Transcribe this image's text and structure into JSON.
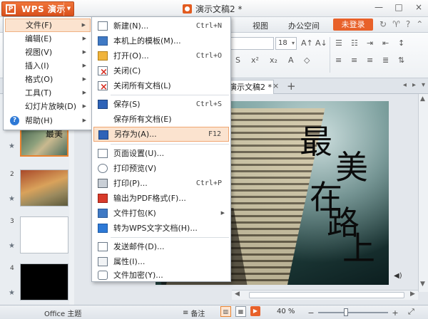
{
  "app": {
    "logo_glyph": "P",
    "menu_button_label": "WPS 演示",
    "doc_title": "演示文稿2 *"
  },
  "window": {
    "minimize": "—",
    "maximize": "□",
    "close": "×"
  },
  "menubar": {
    "tabs": [
      "视图",
      "办公空间"
    ],
    "login_label": "未登录"
  },
  "toolbar": {
    "font_size": "18",
    "grow_font": "A↑",
    "shrink_font": "A↓"
  },
  "doc_tabs": {
    "active_tab": "演示文稿2 *",
    "close": "×",
    "add": "+"
  },
  "thumbnails": {
    "slides": [
      {
        "number": "1",
        "text": "最美"
      },
      {
        "number": "2",
        "text": ""
      },
      {
        "number": "3",
        "text": ""
      },
      {
        "number": "4",
        "text": ""
      }
    ]
  },
  "slide": {
    "text_lines": [
      "最",
      "美",
      "在",
      "路",
      "上"
    ]
  },
  "statusbar": {
    "theme": "Office 主题",
    "notes": "备注",
    "zoom": "40 %",
    "zoom_level": 0.4
  },
  "wps_menu": {
    "items": [
      {
        "label": "文件(F)",
        "has_submenu": true
      },
      {
        "label": "编辑(E)",
        "has_submenu": true
      },
      {
        "label": "视图(V)",
        "has_submenu": true
      },
      {
        "label": "插入(I)",
        "has_submenu": true
      },
      {
        "label": "格式(O)",
        "has_submenu": true
      },
      {
        "label": "工具(T)",
        "has_submenu": true
      },
      {
        "label": "幻灯片放映(D)",
        "has_submenu": true
      },
      {
        "label": "帮助(H)",
        "has_submenu": true
      }
    ]
  },
  "file_menu": {
    "items": [
      {
        "label": "新建(N)...",
        "shortcut": "Ctrl+N",
        "icon": "new-document-icon"
      },
      {
        "label": "本机上的模板(M)...",
        "shortcut": "",
        "icon": "template-icon"
      },
      {
        "label": "打开(O)...",
        "shortcut": "Ctrl+O",
        "icon": "folder-open-icon"
      },
      {
        "label": "关闭(C)",
        "shortcut": "",
        "icon": "close-document-icon"
      },
      {
        "label": "关闭所有文档(L)",
        "shortcut": "",
        "icon": "close-all-icon"
      },
      {
        "label": "保存(S)",
        "shortcut": "Ctrl+S",
        "icon": "save-icon"
      },
      {
        "label": "保存所有文档(E)",
        "shortcut": "",
        "icon": ""
      },
      {
        "label": "另存为(A)...",
        "shortcut": "F12",
        "icon": "save-as-icon"
      },
      {
        "label": "页面设置(U)...",
        "shortcut": "",
        "icon": "page-setup-icon"
      },
      {
        "label": "打印预览(V)",
        "shortcut": "",
        "icon": "print-preview-icon"
      },
      {
        "label": "打印(P)...",
        "shortcut": "Ctrl+P",
        "icon": "print-icon"
      },
      {
        "label": "输出为PDF格式(F)...",
        "shortcut": "",
        "icon": "pdf-icon"
      },
      {
        "label": "文件打包(K)",
        "shortcut": "",
        "icon": "package-icon"
      },
      {
        "label": "转为WPS文字文档(H)...",
        "shortcut": "",
        "icon": "convert-icon"
      },
      {
        "label": "发送邮件(D)...",
        "shortcut": "",
        "icon": "mail-icon"
      },
      {
        "label": "属性(I)...",
        "shortcut": "",
        "icon": "properties-icon"
      },
      {
        "label": "文件加密(Y)...",
        "shortcut": "",
        "icon": "encrypt-icon"
      }
    ]
  },
  "colors": {
    "accent": "#e8612a",
    "menu_highlight": "#fbe3cf",
    "menu_highlight_border": "#f0a672",
    "help_icon": "#2d79d6"
  }
}
